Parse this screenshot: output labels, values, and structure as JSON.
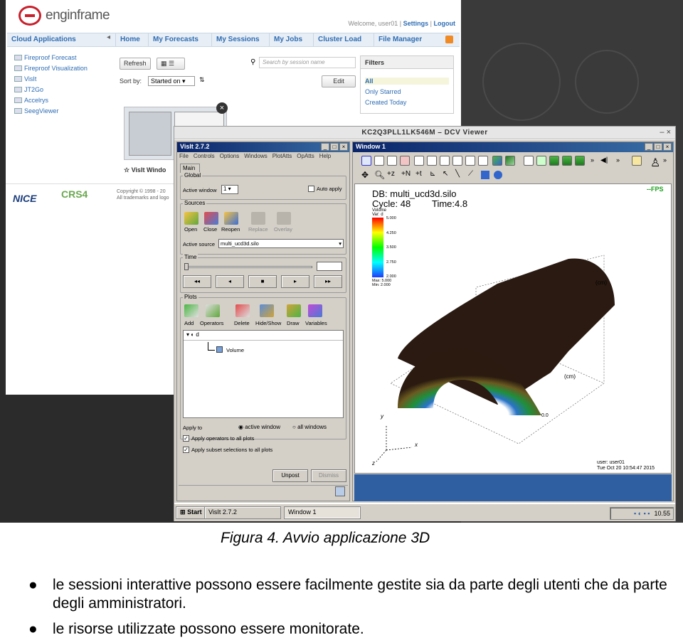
{
  "enginframe": {
    "logo": "enginframe",
    "welcome": "Welcome, user01",
    "settings": "Settings",
    "logout": "Logout",
    "cloud_apps": "Cloud Applications",
    "nav": [
      "Home",
      "My Forecasts",
      "My Sessions",
      "My Jobs",
      "Cluster Load",
      "File Manager"
    ],
    "apps": [
      "Fireproof Forecast",
      "Fireproof Visualization",
      "VisIt",
      "JT2Go",
      "Accelrys",
      "SeegViewer"
    ],
    "refresh": "Refresh",
    "search_placeholder": "Search by session name",
    "sort_label": "Sort by:",
    "sort_value": "Started on",
    "edit": "Edit",
    "filters_title": "Filters",
    "filters": [
      "All",
      "Only Starred",
      "Created Today"
    ],
    "thumb_label": "VisIt Windo",
    "footer_nice": "NICE",
    "footer_crs4": "CRS4",
    "copyright": "Copyright © 1998 - 20",
    "trademarks": "All trademarks and logo"
  },
  "dcv": {
    "title": "KC2Q3PLL1LK546M – DCV Viewer",
    "controls": "–  ×"
  },
  "visit": {
    "title": "VisIt 2.7.2",
    "menu": [
      "File",
      "Controls",
      "Options",
      "Windows",
      "PlotAtts",
      "OpAtts",
      "Help"
    ],
    "tab": "Main",
    "global": "Global",
    "active_window_label": "Active window",
    "active_window_value": "1",
    "auto_apply": "Auto apply",
    "sources": "Sources",
    "source_buttons": [
      "Open",
      "Close",
      "Reopen",
      "Replace",
      "Overlay"
    ],
    "active_source_label": "Active source",
    "active_source_value": "multi_ucd3d.silo",
    "time": "Time",
    "plots": "Plots",
    "plot_buttons": [
      "Add",
      "Operators",
      "Delete",
      "Hide/Show",
      "Draw",
      "Variables"
    ],
    "plot_var": "d",
    "plot_item": "Volume",
    "apply_to": "Apply to",
    "active_window_radio": "active window",
    "all_windows_radio": "all windows",
    "apply_ops": "Apply operators to all plots",
    "apply_subset": "Apply subset selections to all plots",
    "unpost": "Unpost",
    "dismiss": "Dismiss"
  },
  "window1": {
    "title": "Window 1",
    "db": "DB: multi_ucd3d.silo",
    "cycle": "Cycle: 48",
    "time": "Time:4.8",
    "fps": "--FPS",
    "legend_title": "Volume",
    "legend_var": "Var: d",
    "legend_ticks": [
      "5.000",
      "4.250",
      "3.500",
      "2.750",
      "2.000"
    ],
    "legend_max": "Max: 5.000",
    "legend_min": "Min: 2.000",
    "axis_y": "y",
    "axis_x": "x",
    "axis_z": "z",
    "axis_cm1": "(cm)",
    "axis_cm2": "(cm)",
    "axis_zero": "0.0",
    "user": "user: user01",
    "date": "Tue Oct 20 10:54:47 2015"
  },
  "taskbar": {
    "start": "Start",
    "item1": "VisIt 2.7.2",
    "item2": "Window 1",
    "clock": "10.55"
  },
  "doc": {
    "caption": "Figura 4. Avvio applicazione 3D",
    "bullet1": "le sessioni interattive possono essere facilmente gestite sia da parte degli utenti che da parte degli amministratori.",
    "bullet2": "le risorse utilizzate possono essere monitorate.",
    "bullet_char": "●"
  },
  "colors": {
    "brand_red": "#c8202c",
    "link_blue": "#2e6db4",
    "xp_title": "#0a246a",
    "volume_high": "#ff0000",
    "volume_low": "#1e3cff"
  }
}
